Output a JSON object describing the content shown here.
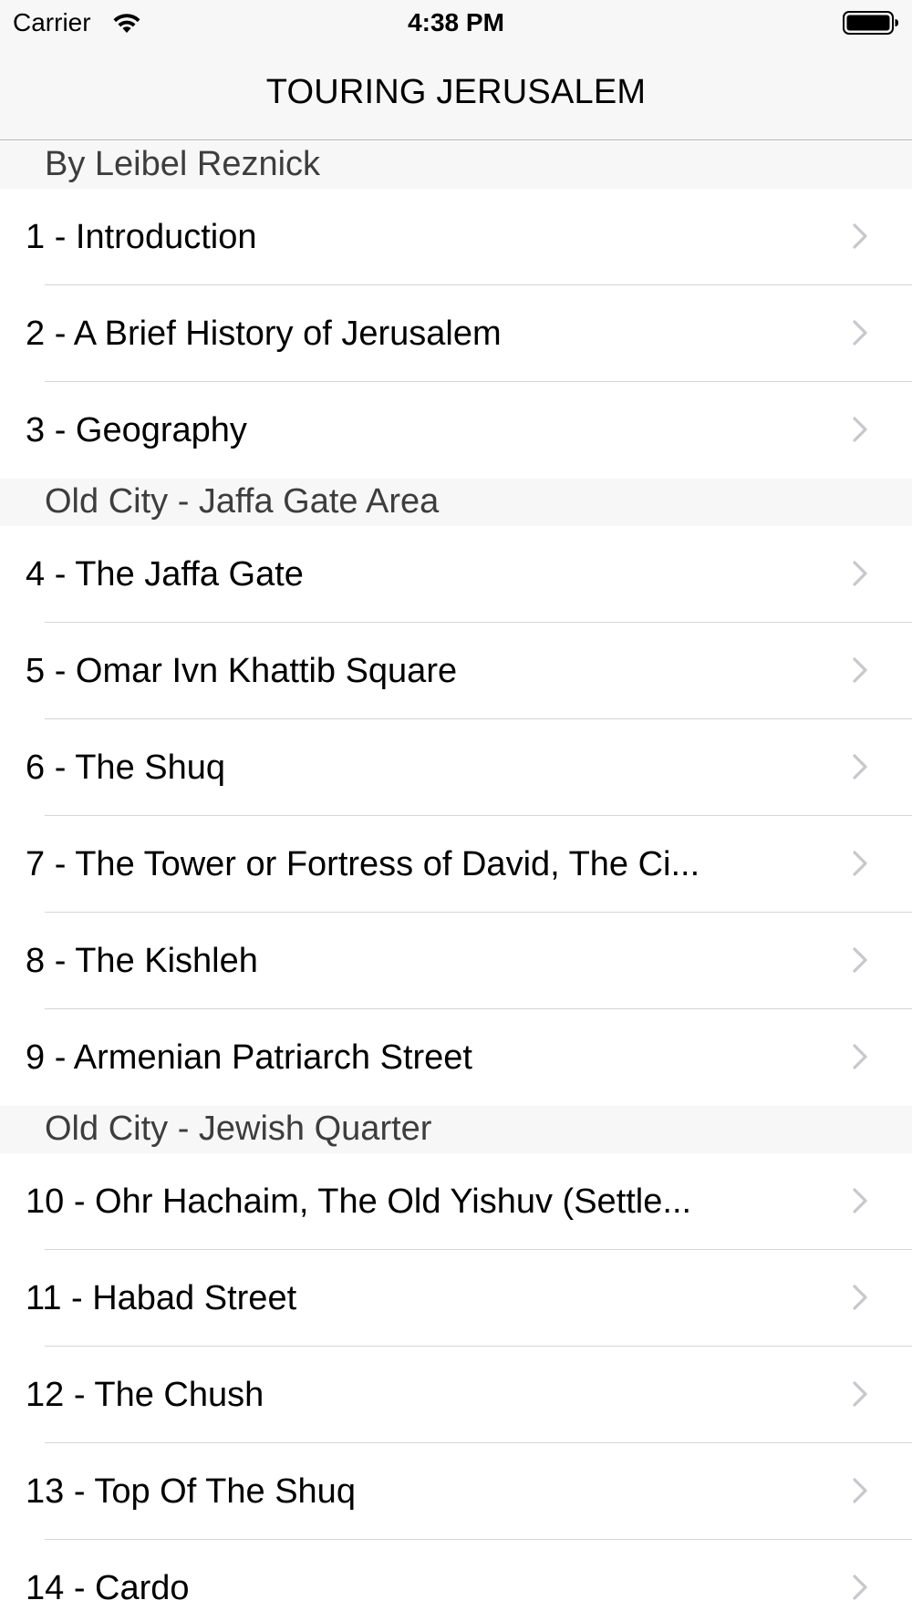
{
  "status_bar": {
    "carrier": "Carrier",
    "time": "4:38 PM",
    "wifi_icon": "wifi-icon",
    "battery_icon": "battery-icon"
  },
  "nav": {
    "title": "TOURING JERUSALEM"
  },
  "sections": [
    {
      "header": "By Leibel Reznick",
      "items": [
        {
          "label": "1 - Introduction"
        },
        {
          "label": "2 - A Brief History of Jerusalem"
        },
        {
          "label": "3 - Geography"
        }
      ]
    },
    {
      "header": "Old City - Jaffa Gate Area",
      "items": [
        {
          "label": "4 - The Jaffa Gate"
        },
        {
          "label": "5 - Omar Ivn Khattib Square"
        },
        {
          "label": "6 - The Shuq"
        },
        {
          "label": "7 - The Tower or Fortress of David, The Ci..."
        },
        {
          "label": "8 - The Kishleh"
        },
        {
          "label": "9 - Armenian Patriarch Street"
        }
      ]
    },
    {
      "header": "Old City - Jewish Quarter",
      "items": [
        {
          "label": "10 - Ohr Hachaim, The Old Yishuv (Settle..."
        },
        {
          "label": "11 - Habad Street"
        },
        {
          "label": "12 - The Chush"
        },
        {
          "label": "13 - Top Of The Shuq"
        },
        {
          "label": "14 - Cardo"
        }
      ]
    }
  ],
  "colors": {
    "bar_background": "#f7f7f7",
    "separator": "#d6d6d6",
    "chevron": "#c7c7cc"
  }
}
